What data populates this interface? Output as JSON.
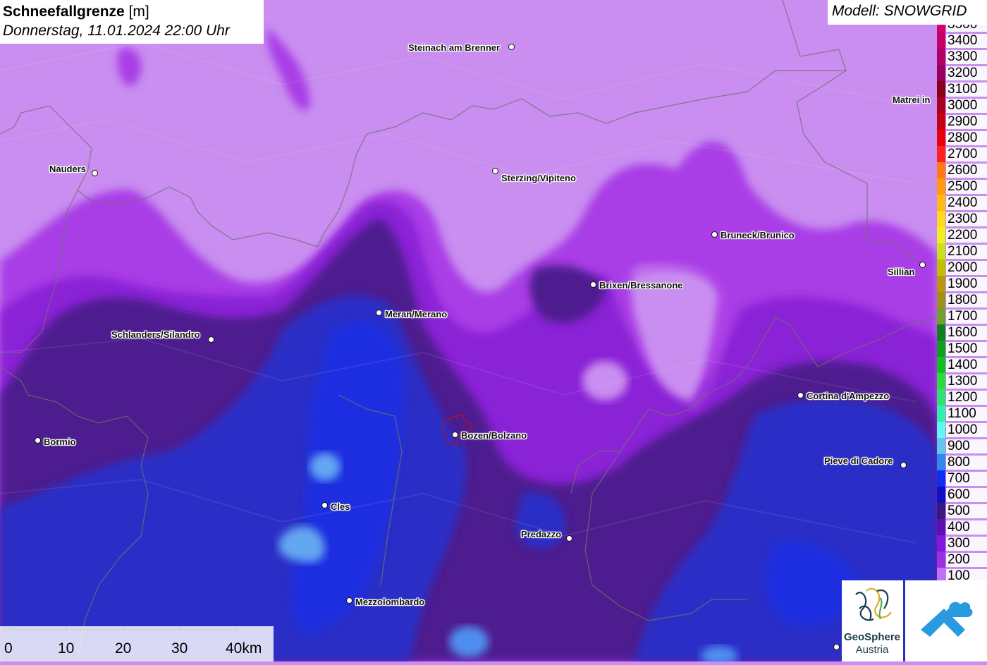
{
  "header": {
    "title_bold": "Schneefallgrenze",
    "title_unit": "[m]",
    "subtitle": "Donnerstag, 11.01.2024 22:00 Uhr"
  },
  "model_label": "Modell: SNOWGRID",
  "legend": [
    {
      "label": "3500",
      "color": "#d4006c"
    },
    {
      "label": "3400",
      "color": "#c4006a"
    },
    {
      "label": "3300",
      "color": "#b00066"
    },
    {
      "label": "3200",
      "color": "#980060"
    },
    {
      "label": "3100",
      "color": "#8a0018"
    },
    {
      "label": "3000",
      "color": "#a8001e"
    },
    {
      "label": "2900",
      "color": "#c80010"
    },
    {
      "label": "2800",
      "color": "#e8000c"
    },
    {
      "label": "2700",
      "color": "#ff2020"
    },
    {
      "label": "2600",
      "color": "#ff7a10"
    },
    {
      "label": "2500",
      "color": "#ff9a10"
    },
    {
      "label": "2400",
      "color": "#ffba18"
    },
    {
      "label": "2300",
      "color": "#ffd820"
    },
    {
      "label": "2200",
      "color": "#f0f020"
    },
    {
      "label": "2100",
      "color": "#c8e020"
    },
    {
      "label": "2000",
      "color": "#c0c000"
    },
    {
      "label": "1900",
      "color": "#b89810"
    },
    {
      "label": "1800",
      "color": "#a09018"
    },
    {
      "label": "1700",
      "color": "#70a030"
    },
    {
      "label": "1600",
      "color": "#108020"
    },
    {
      "label": "1500",
      "color": "#10a020"
    },
    {
      "label": "1400",
      "color": "#10c020"
    },
    {
      "label": "1300",
      "color": "#30d840"
    },
    {
      "label": "1200",
      "color": "#30e070"
    },
    {
      "label": "1100",
      "color": "#30f0b0"
    },
    {
      "label": "1000",
      "color": "#60f8f0"
    },
    {
      "label": "900",
      "color": "#60c8f0"
    },
    {
      "label": "800",
      "color": "#3088f0"
    },
    {
      "label": "700",
      "color": "#1030f0"
    },
    {
      "label": "600",
      "color": "#1010c0"
    },
    {
      "label": "500",
      "color": "#3a1880"
    },
    {
      "label": "400",
      "color": "#6010b0"
    },
    {
      "label": "300",
      "color": "#8018e0"
    },
    {
      "label": "200",
      "color": "#9c30e0"
    },
    {
      "label": "100",
      "color": "#c070f0"
    }
  ],
  "cities": [
    {
      "name": "Steinach am Brenner",
      "id": "steinach"
    },
    {
      "name": "Matrei in",
      "id": "matrei"
    },
    {
      "name": "Nauders",
      "id": "nauders"
    },
    {
      "name": "Sterzing/Vipiteno",
      "id": "sterzing"
    },
    {
      "name": "Bruneck/Brunico",
      "id": "bruneck"
    },
    {
      "name": "Sillian",
      "id": "sillian"
    },
    {
      "name": "Brixen/Bressanone",
      "id": "brixen"
    },
    {
      "name": "Meran/Merano",
      "id": "meran"
    },
    {
      "name": "Schlanders/Silandro",
      "id": "schlanders"
    },
    {
      "name": "Cortina d'Ampezzo",
      "id": "cortina"
    },
    {
      "name": "Bormio",
      "id": "bormio"
    },
    {
      "name": "Bozen/Bolzano",
      "id": "bozen"
    },
    {
      "name": "Pieve di Cadore",
      "id": "pieve"
    },
    {
      "name": "Cles",
      "id": "cles"
    },
    {
      "name": "Predazzo",
      "id": "predazzo"
    },
    {
      "name": "Mezzolombardo",
      "id": "mezzolombardo"
    }
  ],
  "scale": {
    "labels": [
      "0",
      "10",
      "20",
      "30",
      "40km"
    ]
  },
  "logos": {
    "geosphere_line1": "GeoSphere",
    "geosphere_line2": "Austria"
  }
}
